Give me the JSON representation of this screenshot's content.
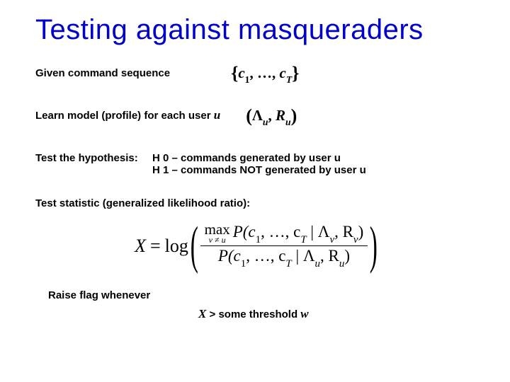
{
  "title": "Testing against masqueraders",
  "given_label": "Given command sequence",
  "given_set": {
    "open": "{",
    "c1": "c",
    "s1": "1",
    "mid": ", …, ",
    "cT": "c",
    "sT": "T",
    "close": "}"
  },
  "model_label_pre": "Learn model (profile) for each user ",
  "model_label_u": "u",
  "model_tuple": {
    "open": "(",
    "L": "Λ",
    "Lu": "u",
    "sep": ", ",
    "R": "R",
    "Ru": "u",
    "close": ")"
  },
  "hypo": {
    "lead": "Test the hypothesis:",
    "h0": "H 0 – commands generated by user u",
    "h1": "H 1 – commands NOT generated by user u"
  },
  "stat_label": "Test statistic (generalized likelihood ratio):",
  "formula": {
    "X": "X",
    "eq": " = ",
    "log": "log",
    "max": "max",
    "maxsub": "v ≠ u",
    "num_rest": "P(c",
    "s1": "1",
    "mid": ", …, c",
    "sT": "T",
    "bar": " | Λ",
    "nv": "v",
    "sep": ", R",
    "rv": "v",
    "close": ")",
    "den_rest": "P(c",
    "den_bar": " | Λ",
    "du": "u",
    "dsep": ", R",
    "ru": "u",
    "dclose": ")"
  },
  "raise": "Raise flag whenever",
  "thresh_x": "X",
  "thresh_mid": " > some threshold ",
  "thresh_w": "w"
}
